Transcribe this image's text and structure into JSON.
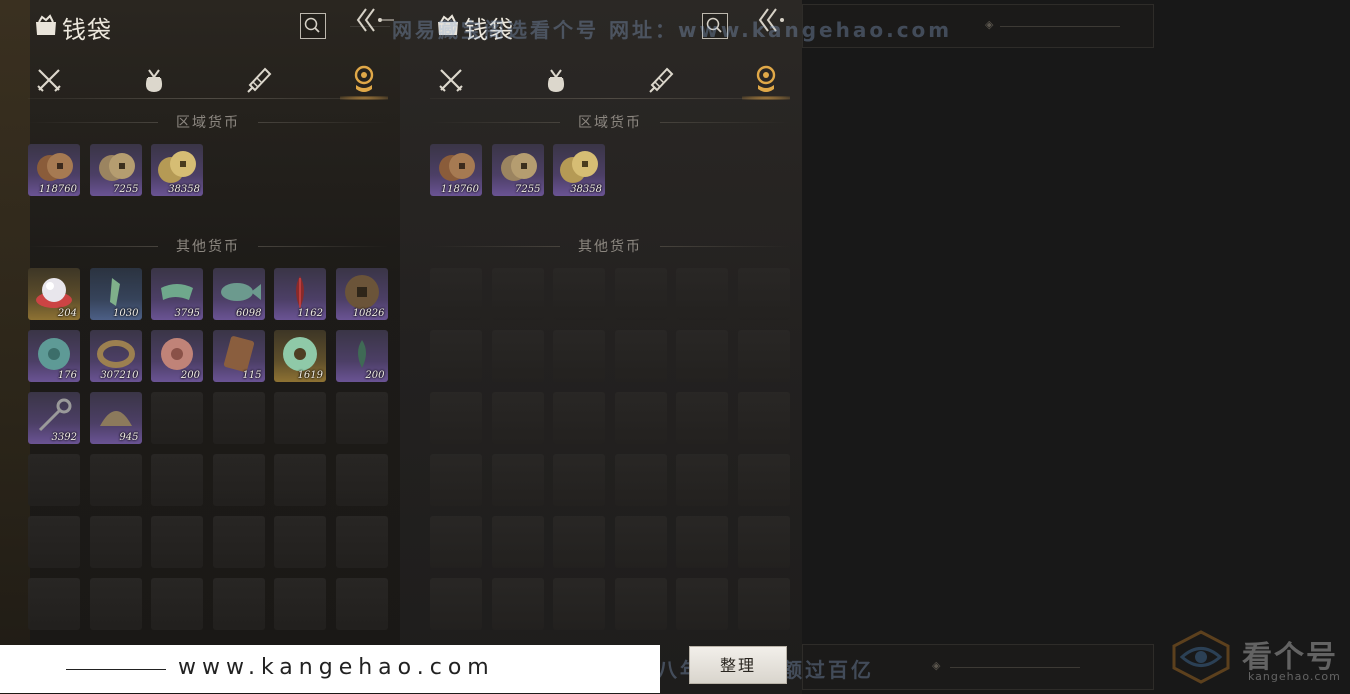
{
  "colors": {
    "accent": "#e0a848",
    "purple_quality": "#6a5394",
    "gold_quality": "#8e7233",
    "blue_quality": "#4c5f86"
  },
  "left_panel": {
    "title": "钱袋",
    "tabs": [
      {
        "icon": "crossed-swords-icon",
        "active": false
      },
      {
        "icon": "pouch-icon",
        "active": false
      },
      {
        "icon": "scroll-icon",
        "active": false
      },
      {
        "icon": "coin-tab-icon",
        "active": true
      }
    ],
    "region_section": "区域货币",
    "other_section": "其他货币",
    "region_items": [
      {
        "icon": "copper-coins-icon",
        "qty": "118760",
        "quality": "purple"
      },
      {
        "icon": "bronze-coins-icon",
        "qty": "7255",
        "quality": "purple"
      },
      {
        "icon": "gold-coins-icon",
        "qty": "38358",
        "quality": "purple"
      }
    ],
    "other_items": [
      {
        "icon": "pearl-icon",
        "qty": "204",
        "quality": "gold"
      },
      {
        "icon": "jade-pendant-icon",
        "qty": "1030",
        "quality": "blue"
      },
      {
        "icon": "green-cloth-icon",
        "qty": "3795",
        "quality": "purple"
      },
      {
        "icon": "jade-fish-icon",
        "qty": "6098",
        "quality": "purple"
      },
      {
        "icon": "red-feather-icon",
        "qty": "1162",
        "quality": "purple"
      },
      {
        "icon": "ancient-coin-icon",
        "qty": "10826",
        "quality": "purple"
      },
      {
        "icon": "turquoise-coin-icon",
        "qty": "176",
        "quality": "purple"
      },
      {
        "icon": "bracelet-icon",
        "qty": "307210",
        "quality": "purple"
      },
      {
        "icon": "pink-coin-icon",
        "qty": "200",
        "quality": "purple"
      },
      {
        "icon": "carved-tile-icon",
        "qty": "115",
        "quality": "purple"
      },
      {
        "icon": "jade-ring-icon",
        "qty": "1619",
        "quality": "gold"
      },
      {
        "icon": "green-sprout-icon",
        "qty": "200",
        "quality": "purple"
      },
      {
        "icon": "key-icon",
        "qty": "3392",
        "quality": "purple"
      },
      {
        "icon": "shell-coin-icon",
        "qty": "945",
        "quality": "purple"
      }
    ]
  },
  "right_panel": {
    "title": "钱袋",
    "region_section": "区域货币",
    "other_section": "其他货币",
    "region_items": [
      {
        "icon": "copper-coins-icon",
        "qty": "118760",
        "quality": "purple"
      },
      {
        "icon": "bronze-coins-icon",
        "qty": "7255",
        "quality": "purple"
      },
      {
        "icon": "gold-coins-icon",
        "qty": "38358",
        "quality": "purple"
      }
    ]
  },
  "sort_button": "整理",
  "watermark_top": "网易藏宝阁选看个号  网址：www.kangehao.com",
  "watermark_bottom": "看个号专业网易游戏八年 平交易额过百亿",
  "site_strip_text": "www.kangehao.com",
  "brand_name": "看个号",
  "brand_sub": "kangehao.com"
}
